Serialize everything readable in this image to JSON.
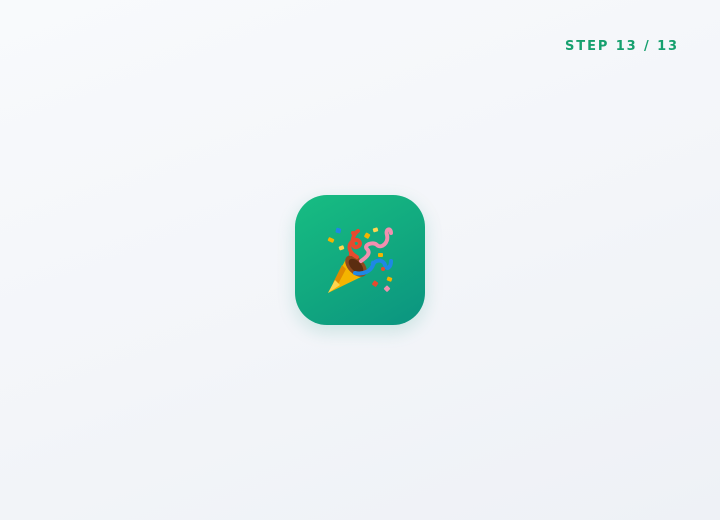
{
  "header": {
    "step_label": "STEP 13 / 13"
  },
  "celebration": {
    "icon": "party-popper-icon",
    "colors": {
      "tile_start": "#17bd82",
      "tile_end": "#0b9480",
      "step_text": "#16a06e"
    }
  }
}
